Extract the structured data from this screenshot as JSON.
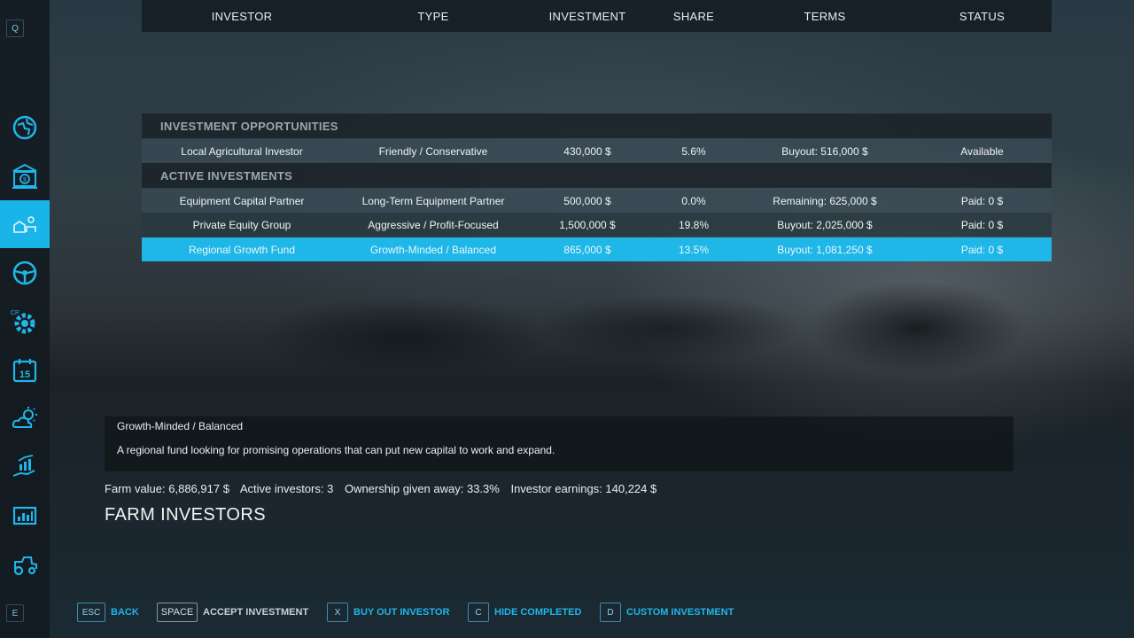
{
  "sidebar": {
    "top_key": "Q",
    "bottom_key": "E",
    "items": [
      {
        "icon": "map-icon"
      },
      {
        "icon": "bank-icon"
      },
      {
        "icon": "farm-investors-icon",
        "active": true
      },
      {
        "icon": "steering-wheel-icon"
      },
      {
        "icon": "settings-gear-icon",
        "badge": "CP"
      },
      {
        "icon": "calendar-icon",
        "value": "15"
      },
      {
        "icon": "weather-icon"
      },
      {
        "icon": "finance-hand-icon"
      },
      {
        "icon": "statistics-icon"
      },
      {
        "icon": "vehicle-icon"
      }
    ]
  },
  "table": {
    "headers": [
      "INVESTOR",
      "TYPE",
      "INVESTMENT",
      "SHARE",
      "TERMS",
      "STATUS"
    ],
    "opportunities_title": "INVESTMENT OPPORTUNITIES",
    "opportunities": [
      {
        "investor": "Local Agricultural Investor",
        "type": "Friendly / Conservative",
        "investment": "430,000 $",
        "share": "5.6%",
        "terms": "Buyout: 516,000 $",
        "status": "Available"
      }
    ],
    "active_title": "ACTIVE INVESTMENTS",
    "active": [
      {
        "investor": "Equipment Capital Partner",
        "type": "Long-Term Equipment Partner",
        "investment": "500,000 $",
        "share": "0.0%",
        "terms": "Remaining: 625,000 $",
        "status": "Paid: 0 $"
      },
      {
        "investor": "Private Equity Group",
        "type": "Aggressive / Profit-Focused",
        "investment": "1,500,000 $",
        "share": "19.8%",
        "terms": "Buyout: 2,025,000 $",
        "status": "Paid: 0 $"
      },
      {
        "investor": "Regional Growth Fund",
        "type": "Growth-Minded / Balanced",
        "investment": "865,000 $",
        "share": "13.5%",
        "terms": "Buyout: 1,081,250 $",
        "status": "Paid: 0 $",
        "selected": true
      }
    ]
  },
  "description": {
    "title": "Growth-Minded / Balanced",
    "text": "A regional fund looking for promising operations that can put new capital to work and expand."
  },
  "stats": {
    "farm_value": "Farm value: 6,886,917 $",
    "active_investors": "Active investors: 3",
    "ownership": "Ownership given away: 33.3%",
    "earnings": "Investor earnings: 140,224 $"
  },
  "page_title": "FARM INVESTORS",
  "footer": {
    "back_key": "ESC",
    "back_label": "BACK",
    "accept_key": "SPACE",
    "accept_label": "ACCEPT INVESTMENT",
    "buyout_key": "X",
    "buyout_label": "BUY OUT INVESTOR",
    "hide_key": "C",
    "hide_label": "HIDE COMPLETED",
    "custom_key": "D",
    "custom_label": "CUSTOM INVESTMENT"
  },
  "colors": {
    "accent": "#1fb6e8",
    "panel": "#141c22"
  }
}
